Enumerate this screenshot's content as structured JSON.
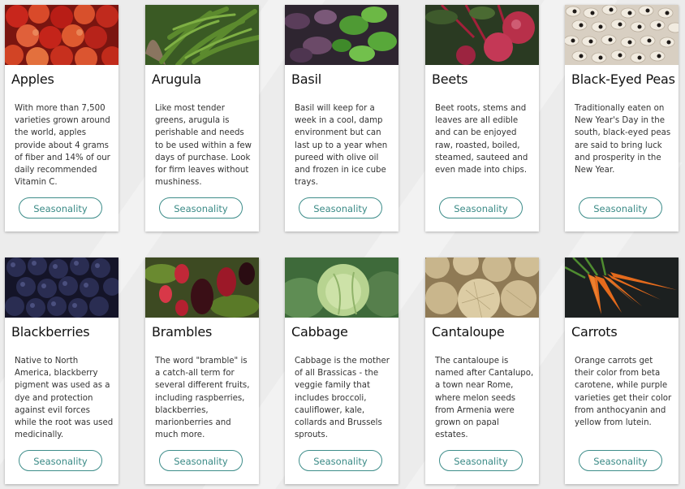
{
  "button_label": "Seasonality",
  "cards": [
    {
      "name": "Apples",
      "desc": "With more than 7,500 varieties grown around the world, apples provide about 4 grams of fiber and 14% of our daily recommended Vitamin C."
    },
    {
      "name": "Arugula",
      "desc": "Like most tender greens, arugula is perishable and needs to be used within a few days of purchase. Look for firm leaves without mushiness."
    },
    {
      "name": "Basil",
      "desc": "Basil will keep for a week in a cool, damp environment but can last up to a year when pureed with olive oil and frozen in ice cube trays."
    },
    {
      "name": "Beets",
      "desc": "Beet roots, stems and leaves are all edible and can be enjoyed raw, roasted, boiled, steamed, sauteed and even made into chips."
    },
    {
      "name": "Black-Eyed Peas",
      "desc": "Traditionally eaten on New Year's Day in the south, black-eyed peas are said to bring luck and prosperity in the New Year."
    },
    {
      "name": "Blackberries",
      "desc": "Native to North America, blackberry pigment was used as a dye and protection against evil forces while the root was used medicinally."
    },
    {
      "name": "Brambles",
      "desc": "The word \"bramble\" is a catch-all term for several different fruits, including raspberries, blackberries, marionberries and much more."
    },
    {
      "name": "Cabbage",
      "desc": "Cabbage is the mother of all Brassicas - the veggie family that includes broccoli, cauliflower, kale, collards and Brussels sprouts."
    },
    {
      "name": "Cantaloupe",
      "desc": "The cantaloupe is named after Cantalupo, a town near Rome, where melon seeds from Armenia were grown on papal estates."
    },
    {
      "name": "Carrots",
      "desc": "Orange carrots get their color from beta carotene, while purple varieties get their color from anthocyanin and yellow from lutein."
    }
  ]
}
